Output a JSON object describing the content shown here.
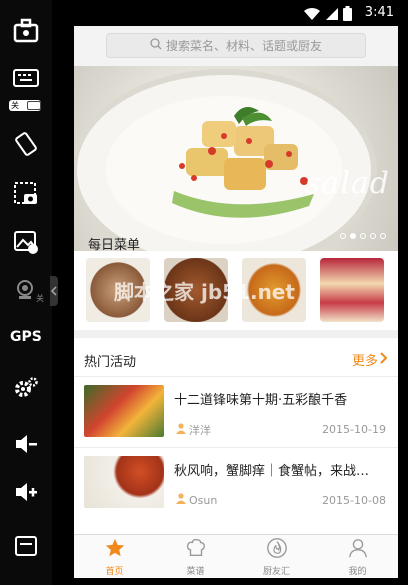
{
  "status_bar": {
    "time": "3:41"
  },
  "emulator_sidebar": {
    "keyboard_toggle_label": "关",
    "camera_toggle_label": "关",
    "gps_label": "GPS"
  },
  "search": {
    "placeholder": "搜索菜名、材料、话题或厨友"
  },
  "banner": {
    "overlay_text": "salad",
    "page_count": 5,
    "active_page": 2
  },
  "daily_menu": {
    "title": "每日菜单",
    "watermark": "脚本之家 jb51.net"
  },
  "activities": {
    "title": "热门活动",
    "more_label": "更多",
    "items": [
      {
        "title": "十二道锋味第十期·五彩酿千香",
        "author": "洋洋",
        "date": "2015-10-19"
      },
      {
        "title": "秋风响，蟹脚痒｜食蟹帖，来战…",
        "author": "Osun",
        "date": "2015-10-08"
      }
    ]
  },
  "tabs": [
    {
      "label": "首页",
      "icon": "star-icon",
      "active": true
    },
    {
      "label": "菜谱",
      "icon": "chef-hat-icon",
      "active": false
    },
    {
      "label": "厨友汇",
      "icon": "flame-icon",
      "active": false
    },
    {
      "label": "我的",
      "icon": "user-icon",
      "active": false
    }
  ],
  "colors": {
    "accent": "#f08a1c",
    "background": "#ffffff",
    "frame": "#000000"
  }
}
